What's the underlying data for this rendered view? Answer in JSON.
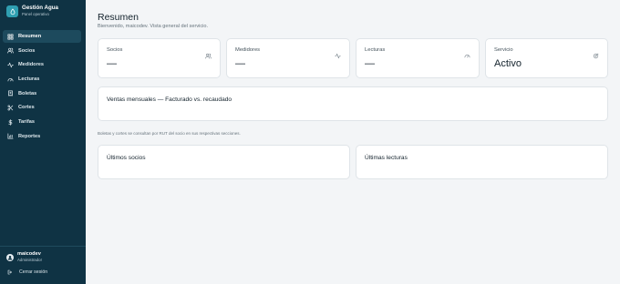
{
  "sidebar": {
    "brand_title": "Gestión Agua",
    "brand_subtitle": "Panel operativo",
    "items": [
      {
        "label": "Resumen",
        "icon": "dashboard-icon"
      },
      {
        "label": "Socios",
        "icon": "users-icon"
      },
      {
        "label": "Medidores",
        "icon": "pulse-icon"
      },
      {
        "label": "Lecturas",
        "icon": "gauge-icon"
      },
      {
        "label": "Boletas",
        "icon": "receipt-icon"
      },
      {
        "label": "Cortes",
        "icon": "scissors-icon"
      },
      {
        "label": "Tarifas",
        "icon": "dollar-icon"
      },
      {
        "label": "Reportes",
        "icon": "bar-chart-icon"
      }
    ],
    "active_item": "Resumen",
    "user_name": "maicodev",
    "user_role": "Administrador",
    "logout_label": "Cerrar sesión"
  },
  "main": {
    "title": "Resumen",
    "subtitle": "Bienvenido, maicodev. Vista general del servicio.",
    "stats": [
      {
        "label": "Socios",
        "value": "—",
        "icon": "users-icon"
      },
      {
        "label": "Medidores",
        "value": "—",
        "icon": "pulse-icon"
      },
      {
        "label": "Lecturas",
        "value": "—",
        "icon": "gauge-icon"
      },
      {
        "label": "Servicio",
        "value": "Activo",
        "icon": "refresh-icon"
      }
    ],
    "chart_panel_title": "Ventas mensuales — Facturado vs. recaudado",
    "note": "Boletas y cortes se consultan por RUT del socio en sus respectivas secciones.",
    "recent_socios_title": "Últimos socios",
    "recent_lecturas_title": "Últimas lecturas"
  },
  "colors": {
    "sidebar_bg": "#0f3344",
    "sidebar_active": "#1d4a5d",
    "brand_accent": "#2f9fb1",
    "page_bg": "#f3f5f7",
    "card_bg": "#ffffff"
  }
}
